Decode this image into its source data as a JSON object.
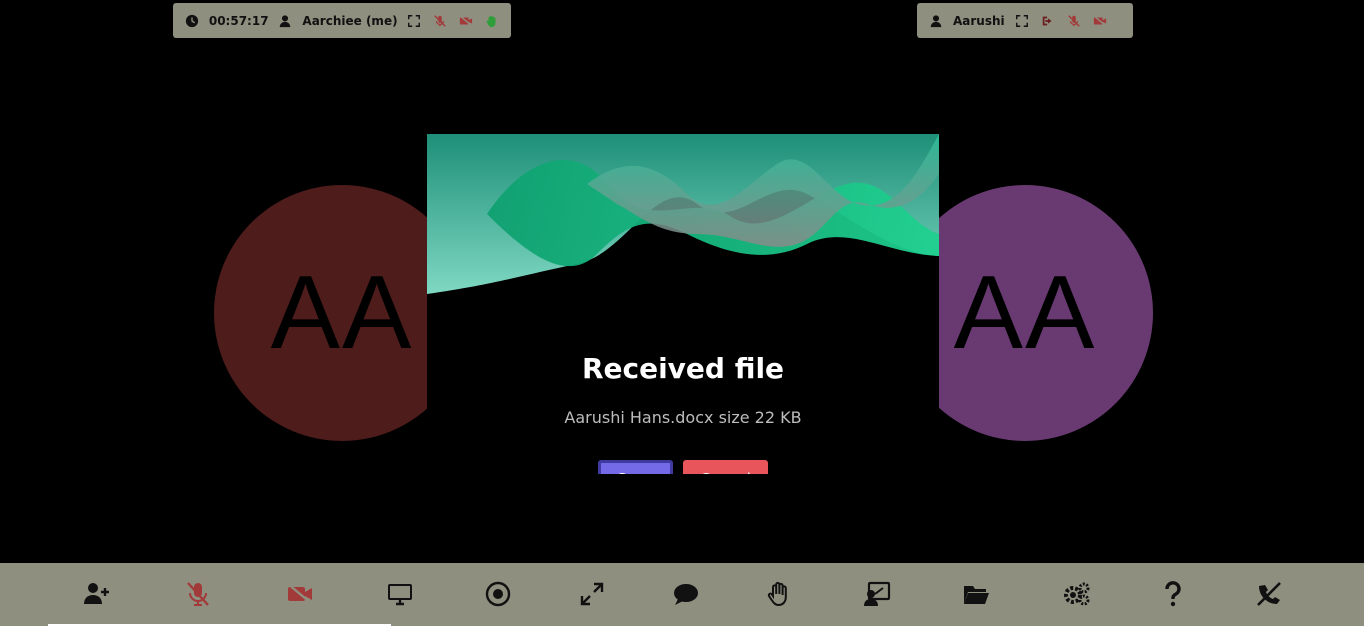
{
  "colors": {
    "bar_bg": "#8f8f80",
    "avatar_left": "#4d1c1b",
    "avatar_right": "#693a72",
    "save": "#7469e6",
    "cancel": "#e8555a",
    "muted_red": "#a23a3a",
    "hand_green": "#2f9e3a"
  },
  "self_bar": {
    "timer": "00:57:17",
    "name": "Aarchiee (me)",
    "icons": [
      "clock-icon",
      "user-icon",
      "fullscreen-icon",
      "mic-off-icon",
      "video-off-icon",
      "raised-hand-icon"
    ]
  },
  "peer_bar": {
    "name": "Aarushi",
    "icons": [
      "user-icon",
      "fullscreen-icon",
      "kick-out-icon",
      "mic-off-icon",
      "video-off-icon"
    ]
  },
  "avatars": {
    "left_initials": "AA",
    "right_initials": "AA"
  },
  "modal": {
    "title": "Received file",
    "subtitle": "Aarushi Hans.docx size 22 KB",
    "save_label": "Save",
    "cancel_label": "Cancel"
  },
  "toolbar": {
    "buttons": [
      "add-participant-icon",
      "mic-off-icon",
      "video-off-icon",
      "screen-share-icon",
      "record-icon",
      "fullscreen-icon",
      "chat-icon",
      "raise-hand-icon",
      "whiteboard-icon",
      "file-share-icon",
      "settings-icon",
      "help-icon",
      "leave-call-icon"
    ]
  }
}
